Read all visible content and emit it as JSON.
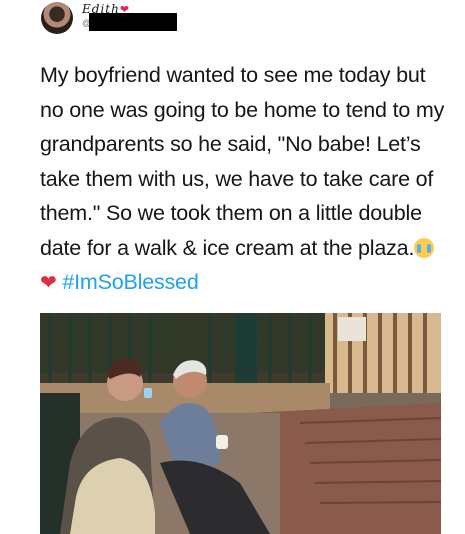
{
  "author": {
    "display_name": "Edith",
    "heart_emoji": "❤",
    "handle_prefix": "@"
  },
  "tweet": {
    "text": "My boyfriend wanted to see me today but no one was going to be home to tend to my grandparents so he said, \"No babe! Let’s take them with us, we have to take care of them.\" So we took them on a little double date for a walk & ice cream at the plaza.",
    "emojis": [
      "loudly-crying-face",
      "red-heart"
    ],
    "hashtag": "#ImSoBlessed"
  },
  "colors": {
    "text": "#14171a",
    "hashtag": "#1da1f2",
    "muted": "#657786"
  }
}
